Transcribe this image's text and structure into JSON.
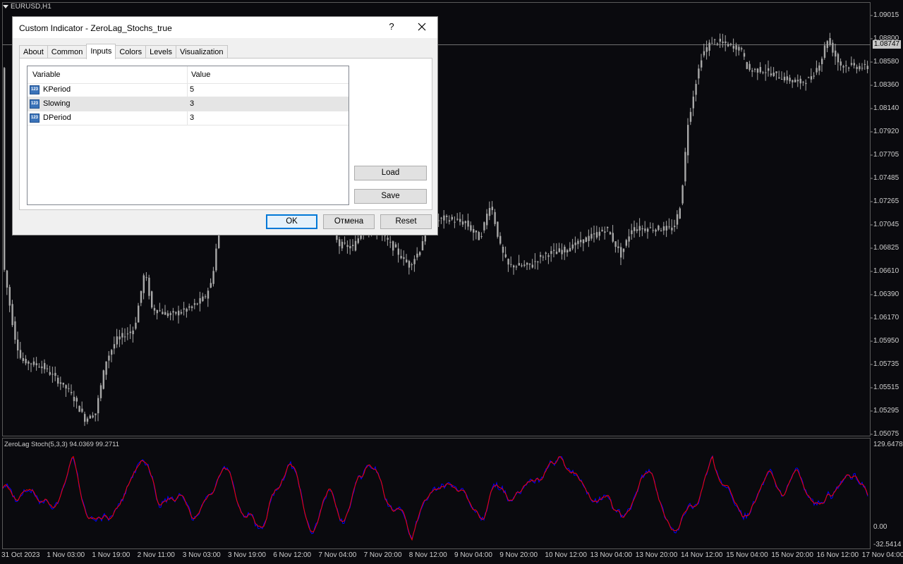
{
  "chart": {
    "symbol_title": "EURUSD,H1",
    "current_price": "1.08747",
    "price_axis": [
      "1.09015",
      "1.08800",
      "1.08580",
      "1.08360",
      "1.08140",
      "1.07920",
      "1.07705",
      "1.07485",
      "1.07265",
      "1.07045",
      "1.06825",
      "1.06610",
      "1.06390",
      "1.06170",
      "1.05950",
      "1.05735",
      "1.05515",
      "1.05295",
      "1.05075"
    ],
    "time_axis": [
      "31 Oct 2023",
      "1 Nov 03:00",
      "1 Nov 19:00",
      "2 Nov 11:00",
      "3 Nov 03:00",
      "3 Nov 19:00",
      "6 Nov 12:00",
      "7 Nov 04:00",
      "7 Nov 20:00",
      "8 Nov 12:00",
      "9 Nov 04:00",
      "9 Nov 20:00",
      "10 Nov 12:00",
      "13 Nov 04:00",
      "13 Nov 20:00",
      "14 Nov 12:00",
      "15 Nov 04:00",
      "15 Nov 20:00",
      "16 Nov 12:00",
      "17 Nov 04:00"
    ],
    "indicator": {
      "title": "ZeroLag Stoch(5,3,3) 94.0369 99.2711",
      "max_label": "129.6478",
      "zero_label": "0.00",
      "min_label": "-32.5414",
      "main_color": "#0000ff",
      "signal_color": "#ff0000"
    },
    "candle_color": "#a8a8a8"
  },
  "dialog": {
    "title": "Custom Indicator - ZeroLag_Stochs_true",
    "help_label": "?",
    "tabs": [
      {
        "label": "About"
      },
      {
        "label": "Common"
      },
      {
        "label": "Inputs"
      },
      {
        "label": "Colors"
      },
      {
        "label": "Levels"
      },
      {
        "label": "Visualization"
      }
    ],
    "active_tab": "Inputs",
    "grid": {
      "header_variable": "Variable",
      "header_value": "Value",
      "rows": [
        {
          "icon": "numeric-icon",
          "icon_text": "123",
          "variable": "KPeriod",
          "value": "5"
        },
        {
          "icon": "numeric-icon",
          "icon_text": "123",
          "variable": "Slowing",
          "value": "3"
        },
        {
          "icon": "numeric-icon",
          "icon_text": "123",
          "variable": "DPeriod",
          "value": "3"
        }
      ]
    },
    "buttons": {
      "load": "Load",
      "save": "Save",
      "ok": "OK",
      "cancel": "Отмена",
      "reset": "Reset"
    }
  }
}
